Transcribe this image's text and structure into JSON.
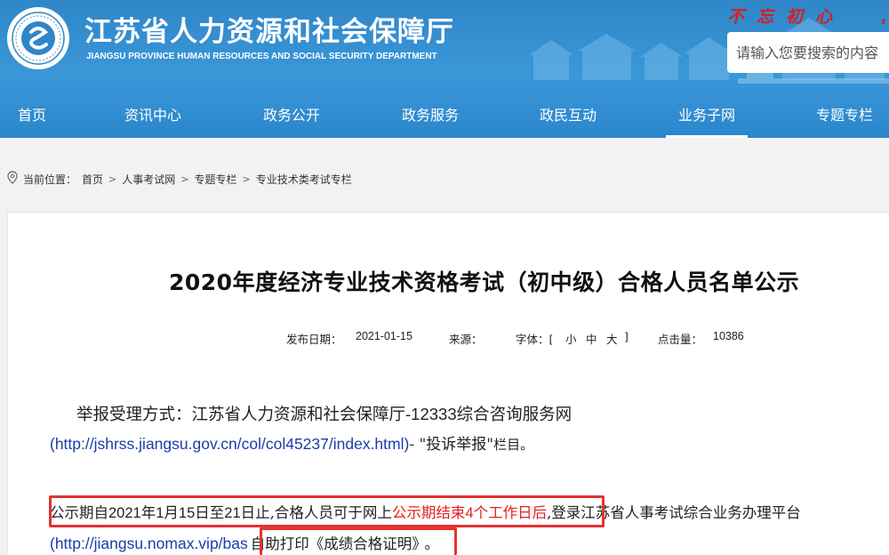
{
  "header": {
    "site_name": "江苏省人力资源和社会保障厅",
    "site_name_en": "JIANGSU PROVINCE HUMAN RESOURCES AND SOCIAL SECURITY DEPARTMENT",
    "slogan": "不忘初心",
    "slogan_tail": "，",
    "search_placeholder": "请输入您要搜索的内容",
    "logo_icon": "hrss-logo-icon",
    "colors": {
      "header_bg": "#3a97d8",
      "slogan": "#d81e1e"
    }
  },
  "nav": {
    "items": [
      {
        "label": "首页"
      },
      {
        "label": "资讯中心"
      },
      {
        "label": "政务公开"
      },
      {
        "label": "政务服务"
      },
      {
        "label": "政民互动"
      },
      {
        "label": "业务子网",
        "active": true
      },
      {
        "label": "专题专栏"
      }
    ]
  },
  "breadcrumb": {
    "prefix": "当前位置：",
    "items": [
      "首页",
      "人事考试网",
      "专题专栏",
      "专业技术类考试专栏"
    ],
    "separator": ">",
    "icon": "location-pin-icon"
  },
  "article": {
    "title": "2020年度经济专业技术资格考试（初中级）合格人员名单公示",
    "meta": {
      "date_label": "发布日期：",
      "date": "2021-01-15",
      "source_label": "来源：",
      "font_label": "字体：[",
      "font_small": "小",
      "font_medium": "中",
      "font_large": "大",
      "font_close": "]",
      "clicks_label": "点击量：",
      "clicks": "10386"
    },
    "p1_text_a": "举报受理方式：江苏省人力资源和社会保障厅",
    "p1_text_b": "-12333",
    "p1_text_c": "综合咨询服务网",
    "p2_paren_open": "(",
    "p2_link": "http://jshrss.jiangsu.gov.cn/col/col45237/index.html",
    "p2_paren_close": ")",
    "p2_text_a": "- \"投诉举报\"",
    "p2_text_b": "栏目。",
    "p3_text_a": "公示期自",
    "p3_num_a": "2021",
    "p3_text_b": "年",
    "p3_num_b": "1",
    "p3_text_c": "月",
    "p3_num_c": "15",
    "p3_text_d": "日至",
    "p3_num_d": "21",
    "p3_text_e": "日止,合格人员可于网上",
    "p3_red_a": "公示期结束",
    "p3_red_num": "4",
    "p3_red_b": "个工作日后",
    "p3_text_f": ",登录江苏省人事考试综合业务办理平台",
    "p4_paren_open": "(",
    "p4_link": "http://jiangsu.nomax.vip/bas",
    "p4_text_a": "自助打印《成绩合格证明》",
    "p4_text_b": "。",
    "highlight_color": "#e23232"
  }
}
